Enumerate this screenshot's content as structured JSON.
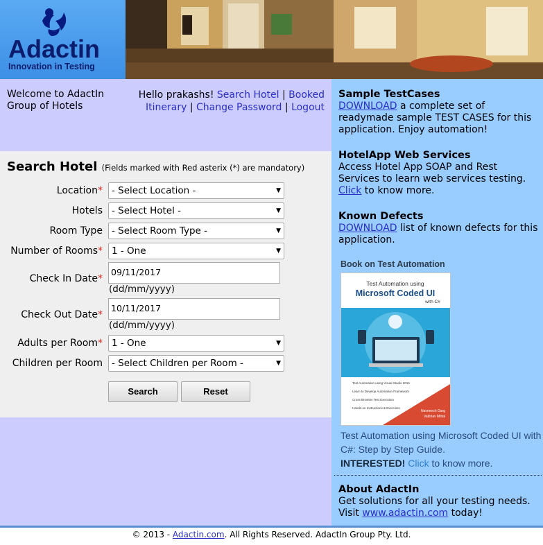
{
  "logo": {
    "brand": "Adactin",
    "tagline": "Innovation in Testing"
  },
  "welcome": {
    "text": "Welcome to AdactIn Group of Hotels",
    "hello": "Hello prakashs!",
    "links": [
      "Search Hotel",
      "Booked Itinerary",
      "Change Password",
      "Logout"
    ]
  },
  "search": {
    "title": "Search Hotel",
    "note": "(Fields marked with Red asterix (*) are mandatory)",
    "fields": {
      "location": {
        "label": "Location",
        "value": "- Select Location -"
      },
      "hotels": {
        "label": "Hotels",
        "value": "- Select Hotel -"
      },
      "room_type": {
        "label": "Room Type",
        "value": "- Select Room Type -"
      },
      "rooms": {
        "label": "Number of Rooms",
        "value": "1 - One"
      },
      "check_in": {
        "label": "Check In Date",
        "value": "09/11/2017",
        "hint": "(dd/mm/yyyy)"
      },
      "check_out": {
        "label": "Check Out Date",
        "value": "10/11/2017",
        "hint": "(dd/mm/yyyy)"
      },
      "adults": {
        "label": "Adults per Room",
        "value": "1 - One"
      },
      "children": {
        "label": "Children per Room",
        "value": "- Select Children per Room -"
      }
    },
    "required_mark": "*",
    "search_label": "Search",
    "reset_label": "Reset"
  },
  "sidebar": {
    "sample": {
      "title": "Sample TestCases",
      "link": "DOWNLOAD",
      "text": " a complete set of readymade sample TEST CASES for this application. Enjoy automation!"
    },
    "services": {
      "title": "HotelApp Web Services",
      "text": "Access Hotel App SOAP and Rest Services to learn web services testing.",
      "link": "Click",
      "text2": " to know more."
    },
    "defects": {
      "title": "Known Defects",
      "link": "DOWNLOAD",
      "text": " list of known defects for this application."
    },
    "book": {
      "title": "Book on Test Automation",
      "cover_top": "Test Automation using",
      "cover_main": "Microsoft Coded UI",
      "cover_sub": "with C#",
      "cover_points": [
        "Test Automation using Visual Studio 2015",
        "Learn to Develop Automation Framework",
        "Cross Browser Test Execution",
        "Hands-on Instructions & Exercises"
      ],
      "cover_authors": [
        "Navneesh Garg",
        "Vaibhav Mittal"
      ],
      "desc": "Test Automation using Microsoft Coded UI with C#: Step by Step Guide.",
      "interested": "INTERESTED!",
      "link": "Click",
      "tail": " to know more."
    },
    "about": {
      "title": "About AdactIn",
      "text": "Get solutions for all your testing needs.",
      "visit": "Visit ",
      "link": "www.adactin.com",
      "tail": " today!"
    }
  },
  "footer": {
    "prefix": "© 2013 - ",
    "link": "Adactin.com",
    "suffix": ". All Rights Reserved. AdactIn Group Pty. Ltd."
  },
  "colors": {
    "sidebar": "#99ccff",
    "welcome": "#ccccff",
    "form": "#efefef",
    "link": "#2a2fc9",
    "required": "#e0261f"
  }
}
